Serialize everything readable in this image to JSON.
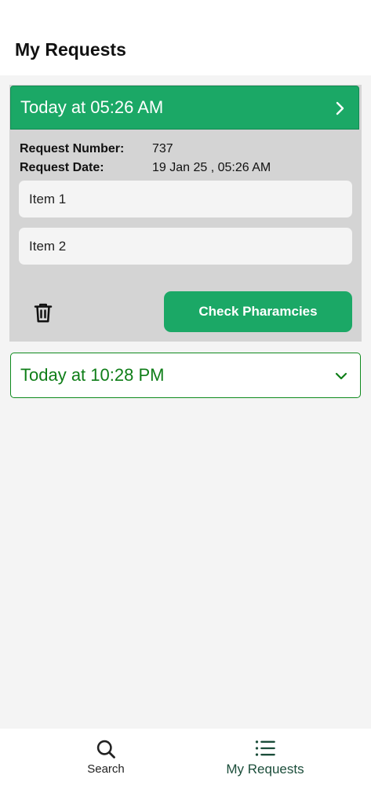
{
  "header": {
    "title": "My Requests"
  },
  "requests": [
    {
      "title": "Today at 05:26 AM",
      "expanded": true,
      "request_number_label": "Request Number:",
      "request_number": "737",
      "request_date_label": "Request Date:",
      "request_date": "19 Jan 25 , 05:26 AM",
      "items": [
        "Item 1",
        "Item 2"
      ],
      "action_label": "Check Pharamcies"
    },
    {
      "title": "Today at 10:28 PM",
      "expanded": false
    }
  ],
  "bottom_nav": {
    "items": [
      {
        "label": "Search",
        "icon": "search-icon",
        "active": false
      },
      {
        "label": "My Requests",
        "icon": "list-icon",
        "active": true
      }
    ]
  },
  "colors": {
    "accent": "#1ba866",
    "accent_dark_text": "#0f7e18",
    "nav_active": "#1b4d3a",
    "card_body": "#d4d4d4",
    "background": "#f4f4f4"
  }
}
